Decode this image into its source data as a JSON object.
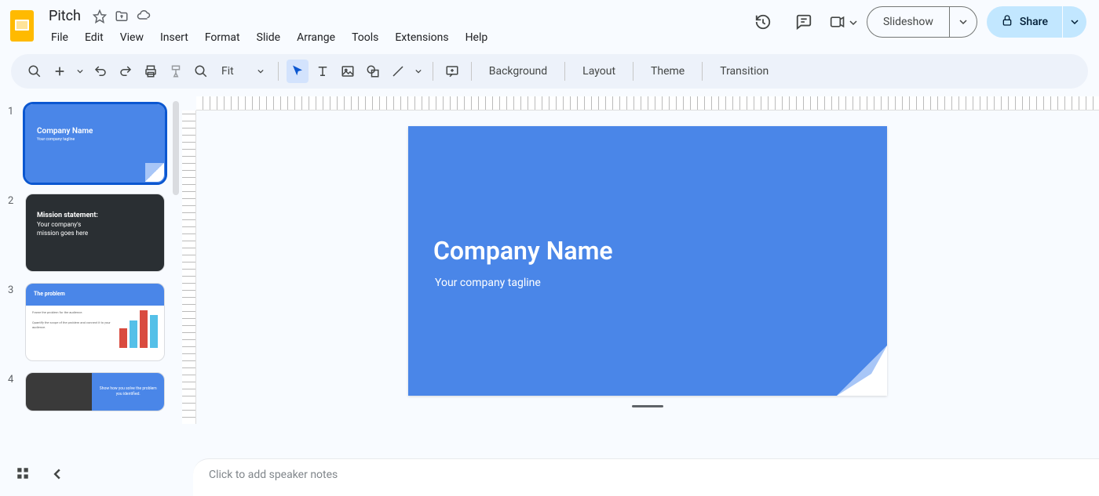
{
  "doc": {
    "title": "Pitch"
  },
  "menu": {
    "file": "File",
    "edit": "Edit",
    "view": "View",
    "insert": "Insert",
    "format": "Format",
    "slide": "Slide",
    "arrange": "Arrange",
    "tools": "Tools",
    "extensions": "Extensions",
    "help": "Help"
  },
  "header_buttons": {
    "slideshow": "Slideshow",
    "share": "Share"
  },
  "toolbar": {
    "zoom": "Fit",
    "background": "Background",
    "layout": "Layout",
    "theme": "Theme",
    "transition": "Transition"
  },
  "slide": {
    "title": "Company Name",
    "subtitle": "Your company tagline"
  },
  "thumbs": {
    "numbers": [
      "1",
      "2",
      "3",
      "4"
    ],
    "t1": {
      "title": "Company Name",
      "sub": "Your company tagline"
    },
    "t2": {
      "title": "Mission statement:",
      "body1": "Your company's",
      "body2": "mission goes here"
    },
    "t3": {
      "title": "The problem",
      "text1": "Frame the problem for the audience.",
      "text2": "Quantify the scope of the problem and connect it to your audience."
    },
    "t4": {
      "text": "Show how you solve the problem you identified."
    }
  },
  "speaker_notes_placeholder": "Click to add speaker notes"
}
